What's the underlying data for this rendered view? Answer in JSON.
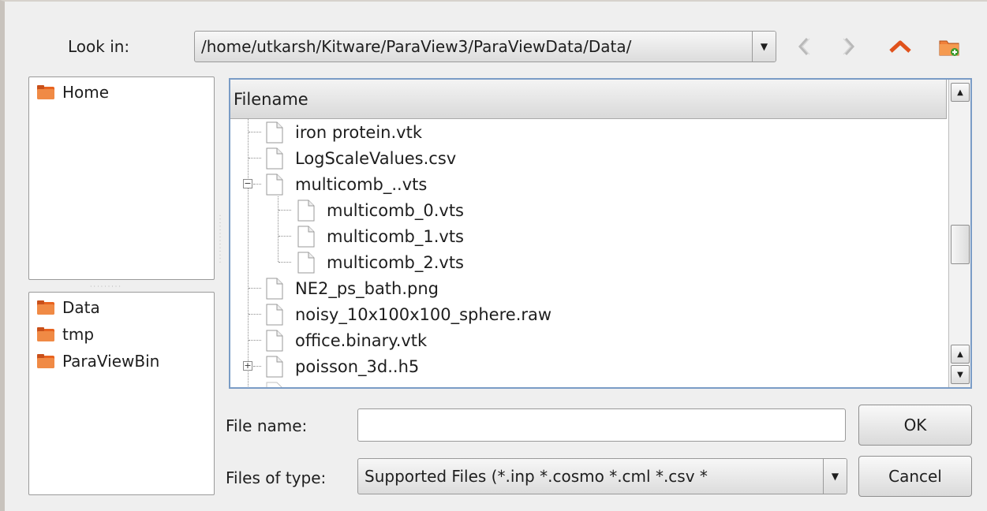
{
  "look_in": {
    "label": "Look in:",
    "path": "/home/utkarsh/Kitware/ParaView3/ParaViewData/Data/"
  },
  "nav": {
    "back_icon": "chevron-left-icon",
    "forward_icon": "chevron-right-icon",
    "up_icon": "chevron-up-icon",
    "new_folder_icon": "new-folder-icon"
  },
  "places": {
    "favorites": [
      {
        "label": "Home"
      }
    ],
    "recent": [
      {
        "label": "Data"
      },
      {
        "label": "tmp"
      },
      {
        "label": "ParaViewBin"
      }
    ]
  },
  "tree": {
    "header": "Filename",
    "rows": [
      {
        "name": "iron protein.vtk"
      },
      {
        "name": "LogScaleValues.csv"
      },
      {
        "name": "multicomb_..vts"
      },
      {
        "name": "multicomb_0.vts"
      },
      {
        "name": "multicomb_1.vts"
      },
      {
        "name": "multicomb_2.vts"
      },
      {
        "name": "NE2_ps_bath.png"
      },
      {
        "name": "noisy_10x100x100_sphere.raw"
      },
      {
        "name": "office.binary.vtk"
      },
      {
        "name": "poisson_3d..h5"
      }
    ]
  },
  "file_name": {
    "label": "File name:",
    "value": ""
  },
  "file_type": {
    "label": "Files of type:",
    "value": "Supported Files (*.inp  *.cosmo  *.cml  *.csv *"
  },
  "buttons": {
    "ok": "OK",
    "cancel": "Cancel"
  },
  "colors": {
    "folder": "#e8631f",
    "up_arrow": "#e0521c",
    "tree_border": "#7a9cc6"
  }
}
